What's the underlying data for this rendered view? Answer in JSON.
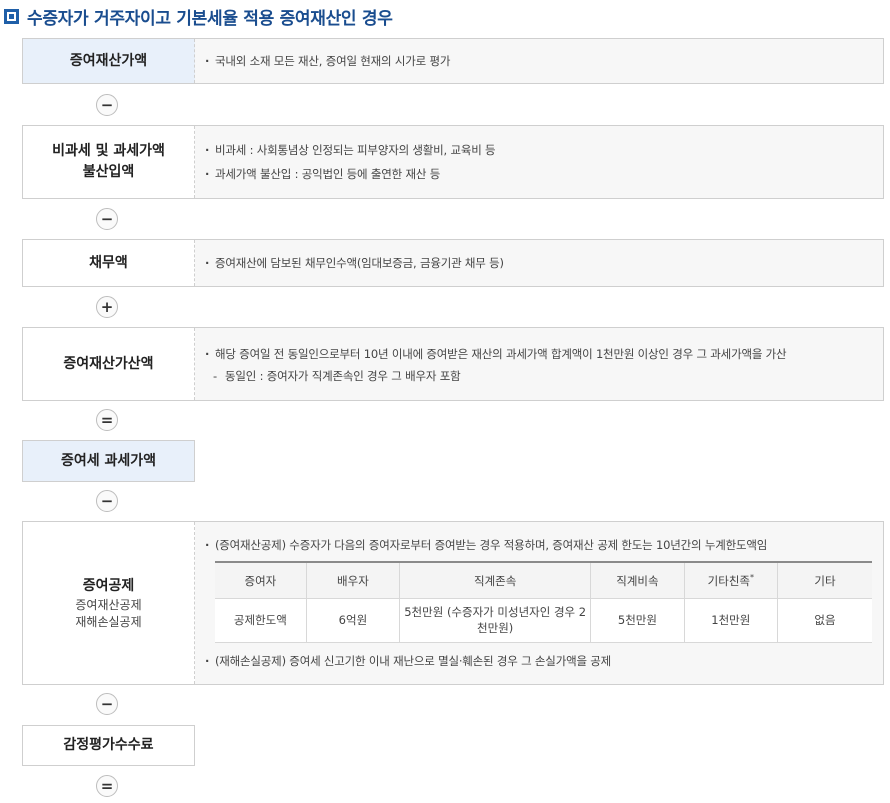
{
  "title": "수증자가 거주자이고 기본세율 적용 증여재산인 경우",
  "rows": {
    "gift_value": {
      "label": "증여재산가액",
      "items": [
        "국내외 소재 모든 재산, 증여일 현재의 시가로 평가"
      ]
    },
    "op1": "−",
    "nontax": {
      "label_line1": "비과세 및 과세가액",
      "label_line2": "불산입액",
      "items": [
        "비과세 : 사회통념상 인정되는 피부양자의 생활비, 교육비 등",
        "과세가액 불산입 : 공익법인 등에 출연한 재산 등"
      ]
    },
    "op2": "−",
    "debt": {
      "label": "채무액",
      "items": [
        "증여재산에 담보된 채무인수액(임대보증금, 금융기관 채무 등)"
      ]
    },
    "op3": "+",
    "addback": {
      "label": "증여재산가산액",
      "item": "해당 증여일 전 동일인으로부터 10년 이내에 증여받은 재산의 과세가액 합계액이 1천만원 이상인 경우 그 과세가액을 가산",
      "sub_item": "동일인 : 증여자가 직계존속인 경우 그 배우자 포함"
    },
    "op4": "=",
    "taxable": {
      "label": "증여세 과세가액"
    },
    "op5": "−",
    "deduction": {
      "label": "증여공제",
      "sub1": "증여재산공제",
      "sub2": "재해손실공제",
      "item_top": "(증여재산공제) 수증자가 다음의 증여자로부터 증여받는 경우 적용하며, 증여재산 공제 한도는 10년간의 누계한도액임",
      "table": {
        "headers": [
          "증여자",
          "배우자",
          "직계존속",
          "직계비속",
          "기타친족",
          "기타"
        ],
        "header_mark": "*",
        "row_label": "공제한도액",
        "cells": [
          "6억원",
          "5천만원 (수증자가 미성년자인 경우 2천만원)",
          "5천만원",
          "1천만원",
          "없음"
        ]
      },
      "item_bottom": "(재해손실공제) 증여세 신고기한 이내 재난으로 멸실·훼손된 경우 그 손실가액을 공제"
    },
    "op6": "−",
    "appraisal": {
      "label": "감정평가수수료"
    },
    "op7": "="
  }
}
